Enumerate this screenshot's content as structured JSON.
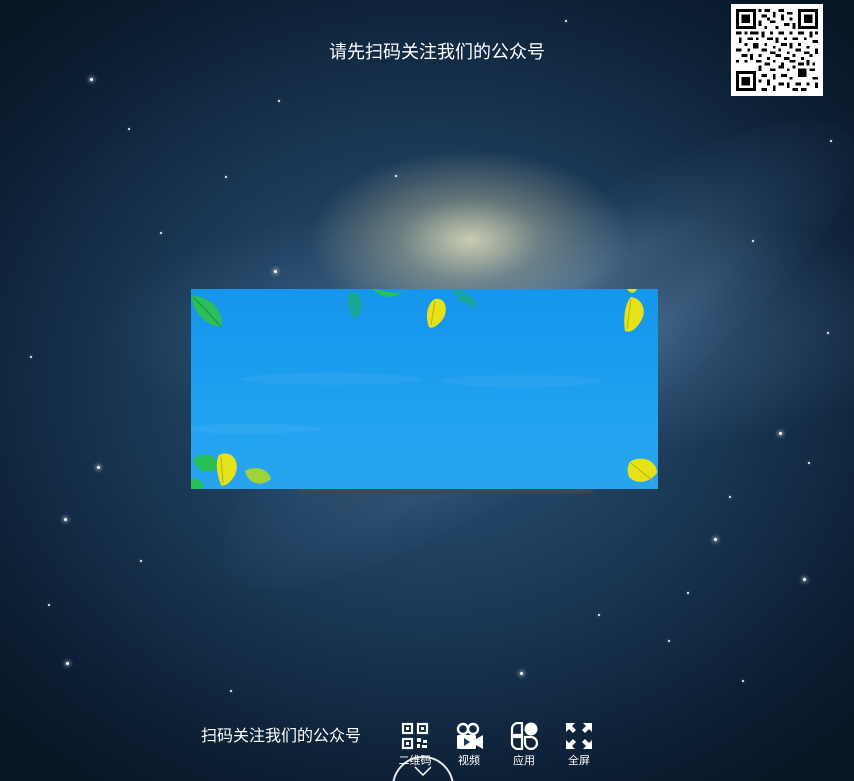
{
  "header": {
    "title": "请先扫码关注我们的公众号"
  },
  "qr_code": {
    "icon": "qr-code-image"
  },
  "footer": {
    "prompt_text": "扫码关注我们的公众号",
    "tools": [
      {
        "label": "二维码",
        "icon": "qr-icon"
      },
      {
        "label": "视频",
        "icon": "video-icon"
      },
      {
        "label": "应用",
        "icon": "apps-icon"
      },
      {
        "label": "全屏",
        "icon": "fullscreen-icon"
      }
    ],
    "scroll_icon": "chevron-down-icon"
  },
  "colors": {
    "panel_blue": "#1a9cee",
    "leaf_green": "#2bbf5a",
    "leaf_yellow": "#e6e21a",
    "leaf_teal": "#1aa59a",
    "text": "#ffffff"
  }
}
